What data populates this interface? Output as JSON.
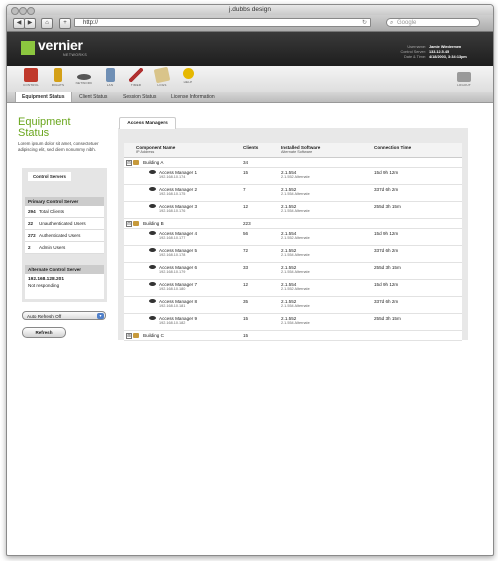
{
  "window": {
    "title": "j.dubbs design",
    "url": "http://",
    "search_placeholder": "Google"
  },
  "header": {
    "logo": "vernier",
    "logo_sub": "NETWORKS",
    "user_rows": [
      {
        "label": "Username:",
        "value": "Jamie Wiedermen"
      },
      {
        "label": "Control Server:",
        "value": "133.12.5.45"
      },
      {
        "label": "Date & Time:",
        "value": "4/18/2003, 3:34:13pm"
      }
    ]
  },
  "nav_icons": [
    {
      "label": "CONTROL",
      "icon": "control-icon",
      "color": "#c0392b"
    },
    {
      "label": "RIGHTS",
      "icon": "rights-icon",
      "color": "#d4a017"
    },
    {
      "label": "NETWORK",
      "icon": "network-icon",
      "color": "#555555"
    },
    {
      "label": "LAN",
      "icon": "lan-icon",
      "color": "#6f8fb5"
    },
    {
      "label": "TIMER",
      "icon": "timer-icon",
      "color": "#b03030"
    },
    {
      "label": "LOGS",
      "icon": "logs-icon",
      "color": "#d9c48a"
    },
    {
      "label": "HELP",
      "icon": "help-icon",
      "color": "#e6b800"
    }
  ],
  "logout_label": "LOGOUT",
  "tabs": [
    "Equipment Status",
    "Client Status",
    "Session Status",
    "License Information"
  ],
  "sidebar": {
    "title_line1": "Equipment",
    "title_line2": "Status",
    "description": "Lorem ipsum dolor sit amet, consectetuer adipiscing elit, sed diem nonummy nibh.",
    "control_servers_tab": "Control Servers",
    "primary": {
      "heading": "Primary Control Server",
      "rows": [
        {
          "count": "294",
          "label": "Total Clients"
        },
        {
          "count": "22",
          "label": "Unauthenticated Users"
        },
        {
          "count": "272",
          "label": "Authenticated Users"
        },
        {
          "count": "2",
          "label": "Admin Users"
        }
      ]
    },
    "alternate": {
      "heading": "Alternate Control Server",
      "ip": "192.168.128.201",
      "status": "Not responding"
    },
    "auto_refresh": "Auto Refresh Off",
    "refresh_button": "Refresh"
  },
  "main": {
    "tab": "Access Managers",
    "columns": {
      "name": "Component Name",
      "name_sub": "IP Address",
      "clients": "Clients",
      "software": "Installed Software",
      "software_sub": "Alternate Software",
      "time": "Connection Time"
    },
    "rows": [
      {
        "kind": "building",
        "toggle": "⊟",
        "name": "Building A",
        "clients": "34"
      },
      {
        "kind": "am",
        "name": "Access Manager 1",
        "ip": "192.168.10.174",
        "clients": "15",
        "sw": "2.1.554",
        "alt": "2.1.552 Alternate",
        "time": "15d 9h 12m"
      },
      {
        "kind": "am",
        "name": "Access Manager 2",
        "ip": "192.168.10.175",
        "clients": "7",
        "sw": "2.1.552",
        "alt": "2.1.554 Alternate",
        "time": "337d 6h 2m"
      },
      {
        "kind": "am",
        "name": "Access Manager 3",
        "ip": "192.168.10.176",
        "clients": "12",
        "sw": "2.1.552",
        "alt": "2.1.554 Alternate",
        "time": "255d 3h 15m"
      },
      {
        "kind": "building",
        "toggle": "⊟",
        "name": "Building B",
        "clients": "223"
      },
      {
        "kind": "am",
        "name": "Access Manager 4",
        "ip": "192.168.10.177",
        "clients": "56",
        "sw": "2.1.554",
        "alt": "2.1.552 Alternate",
        "time": "15d 9h 12m"
      },
      {
        "kind": "am",
        "name": "Access Manager 5",
        "ip": "192.168.10.178",
        "clients": "72",
        "sw": "2.1.552",
        "alt": "2.1.554 Alternate",
        "time": "337d 6h 2m"
      },
      {
        "kind": "am",
        "name": "Access Manager 6",
        "ip": "192.168.10.179",
        "clients": "33",
        "sw": "2.1.552",
        "alt": "2.1.554 Alternate",
        "time": "255d 3h 15m"
      },
      {
        "kind": "am",
        "name": "Access Manager 7",
        "ip": "192.168.10.180",
        "clients": "12",
        "sw": "2.1.554",
        "alt": "2.1.552 Alternate",
        "time": "15d 9h 12m"
      },
      {
        "kind": "am",
        "name": "Access Manager 8",
        "ip": "192.168.10.181",
        "clients": "35",
        "sw": "2.1.552",
        "alt": "2.1.554 Alternate",
        "time": "337d 6h 2m"
      },
      {
        "kind": "am",
        "name": "Access Manager 9",
        "ip": "192.168.10.182",
        "clients": "15",
        "sw": "2.1.552",
        "alt": "2.1.554 Alternate",
        "time": "255d 3h 15m"
      },
      {
        "kind": "building",
        "toggle": "⊞",
        "name": "Building C",
        "clients": "15"
      }
    ]
  }
}
